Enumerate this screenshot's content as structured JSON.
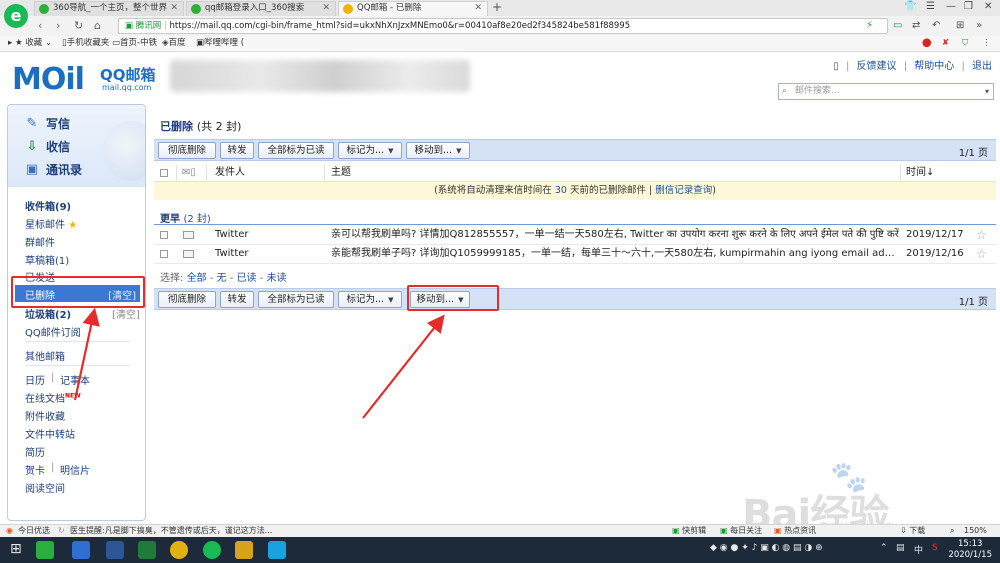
{
  "browser": {
    "tabs": [
      {
        "title": "360导航_一个主页，整个世界"
      },
      {
        "title": "qq邮箱登录入口_360搜索"
      },
      {
        "title": "QQ邮箱 - 已删除"
      }
    ],
    "new_tab": "+",
    "address": {
      "secure_label": "腾讯网",
      "url": "https://mail.qq.com/cgi-bin/frame_html?sid=ukxNhXnJzxMNEmo0&r=00410af8e20ed2f345824be581f88995"
    },
    "bookmarks": [
      "收藏",
      "手机收藏夹",
      "首页-中铁",
      "百度",
      "哔哩哔哩 ( "
    ]
  },
  "header": {
    "logo_text": "MOil",
    "logo_brand": "QQ邮箱",
    "logo_url": "mail.qq.com",
    "links": [
      "反馈建议",
      "帮助中心",
      "退出"
    ],
    "search_placeholder": "邮件搜索..."
  },
  "sidebar": {
    "actions": [
      "写信",
      "收信",
      "通讯录"
    ],
    "inbox": "收件箱(9)",
    "starred": "星标邮件",
    "group_mail": "群邮件",
    "drafts": "草稿箱(1)",
    "sent": "已发送",
    "deleted": "已删除",
    "deleted_clear": "[清空]",
    "spam": "垃圾箱(2)",
    "spam_clear": "[清空]",
    "subscriptions": "QQ邮件订阅",
    "other_mailbox": "其他邮箱",
    "calendar": "日历",
    "notebook": "记事本",
    "online_docs": "在线文档",
    "new_badge": "NEW",
    "attachments": "附件收藏",
    "file_transfer": "文件中转站",
    "resume": "简历",
    "greeting_card": "贺卡",
    "postcard": "明信片",
    "reading_space": "阅读空间"
  },
  "main": {
    "title": "已删除",
    "title_count": "(共 2 封)",
    "toolbar": {
      "delete_forever": "彻底删除",
      "forward": "转发",
      "mark_all_read": "全部标为已读",
      "mark_as": "标记为...",
      "move_to": "移动到..."
    },
    "pager": "1/1 页",
    "columns": {
      "sender": "发件人",
      "subject": "主题",
      "time": "时间↓"
    },
    "notice_before": "(系统将自动清理来信时间在",
    "notice_days": "30",
    "notice_after": "天前的已删除邮件 |",
    "notice_link": "删信记录查询",
    "notice_end": ")",
    "group_label": "更早",
    "group_count": "(2 封)",
    "messages": [
      {
        "from": "Twitter",
        "subject": "亲可以帮我刷单吗? 详情加Q812855557，一单一结一天580左右, Twitter का उपयोग करना शुरू करने के लिए अपने ईमेल पते की पुष्टि करें",
        "date": "2019/12/17"
      },
      {
        "from": "Twitter",
        "subject": "亲能帮我刷单子吗? 详询加Q1059999185，一单一结，每单三十～六十,一天580左右, kumpirmahin ang iyong email address para makapagsimula",
        "date": "2019/12/16"
      }
    ],
    "select": {
      "label": "选择:",
      "all": "全部",
      "none": "无",
      "read": "已读",
      "unread": "未读"
    }
  },
  "statusbar": {
    "left": [
      "今日优选",
      "医生提醒:凡是脚下搞臭，不管遗传或后天，谨记这方法..."
    ],
    "right": [
      "快剪辑",
      "每日关注",
      "热点资讯",
      "下载",
      "150%"
    ]
  },
  "taskbar": {
    "time": "15:13",
    "date": "2020/1/15",
    "ime": "中"
  },
  "watermark": {
    "text": "Bai经验",
    "sub": "jingyan.baidu.com"
  },
  "colors": {
    "accent": "#3a78d1",
    "annotation": "#e52b2b",
    "link": "#1f4e99"
  }
}
